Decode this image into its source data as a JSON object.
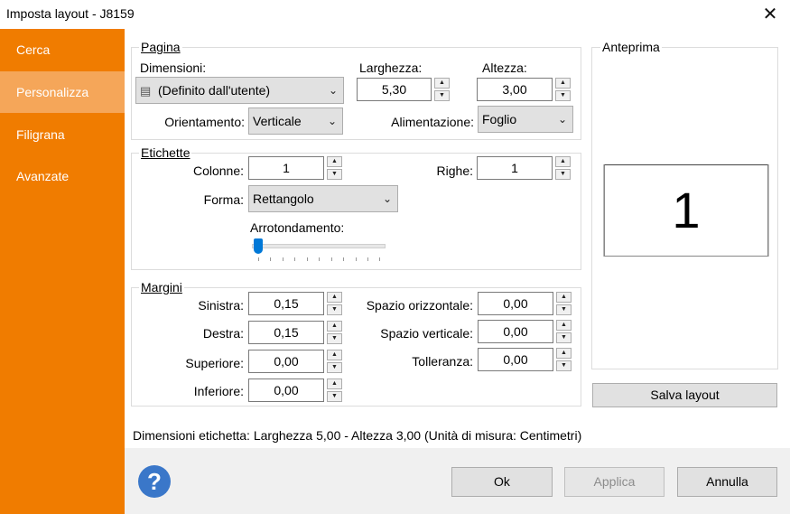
{
  "window": {
    "title": "Imposta layout - J8159",
    "close_glyph": "✕"
  },
  "sidebar": {
    "items": [
      {
        "label": "Cerca"
      },
      {
        "label": "Personalizza"
      },
      {
        "label": "Filigrana"
      },
      {
        "label": "Avanzate"
      }
    ],
    "active": "Personalizza"
  },
  "pagina": {
    "legend": "Pagina",
    "dimensioni_label": "Dimensioni:",
    "dimensioni_value": "(Definito dall'utente)",
    "larghezza_label": "Larghezza:",
    "larghezza_value": "5,30",
    "altezza_label": "Altezza:",
    "altezza_value": "3,00",
    "orientamento_label": "Orientamento:",
    "orientamento_value": "Verticale",
    "alimentazione_label": "Alimentazione:",
    "alimentazione_value": "Foglio"
  },
  "etichette": {
    "legend": "Etichette",
    "colonne_label": "Colonne:",
    "colonne_value": "1",
    "righe_label": "Righe:",
    "righe_value": "1",
    "forma_label": "Forma:",
    "forma_value": "Rettangolo",
    "arrotondamento_label": "Arrotondamento:",
    "arrotondamento_value": 0
  },
  "margini": {
    "legend": "Margini",
    "sinistra_label": "Sinistra:",
    "sinistra_value": "0,15",
    "destra_label": "Destra:",
    "destra_value": "0,15",
    "superiore_label": "Superiore:",
    "superiore_value": "0,00",
    "inferiore_label": "Inferiore:",
    "inferiore_value": "0,00",
    "spazio_orizzontale_label": "Spazio orizzontale:",
    "spazio_orizzontale_value": "0,00",
    "spazio_verticale_label": "Spazio verticale:",
    "spazio_verticale_value": "0,00",
    "tolleranza_label": "Tolleranza:",
    "tolleranza_value": "0,00"
  },
  "anteprima": {
    "legend": "Anteprima",
    "label_number": "1",
    "save_button": "Salva layout"
  },
  "status_text": "Dimensioni etichetta: Larghezza 5,00 - Altezza 3,00 (Unità di misura: Centimetri)",
  "buttons": {
    "ok": "Ok",
    "applica": "Applica",
    "annulla": "Annulla"
  },
  "help_glyph": "?",
  "colors": {
    "sidebar_bg": "#f07c00",
    "sidebar_active": "#f5a659",
    "slider_thumb": "#0078d7",
    "help_icon": "#3a77c9"
  },
  "icons": {
    "close": "close-icon",
    "help": "help-icon",
    "dropdown": "chevron-down-icon",
    "user_defined": "user-defined-icon",
    "spin_up": "spin-up-icon",
    "spin_down": "spin-down-icon"
  }
}
